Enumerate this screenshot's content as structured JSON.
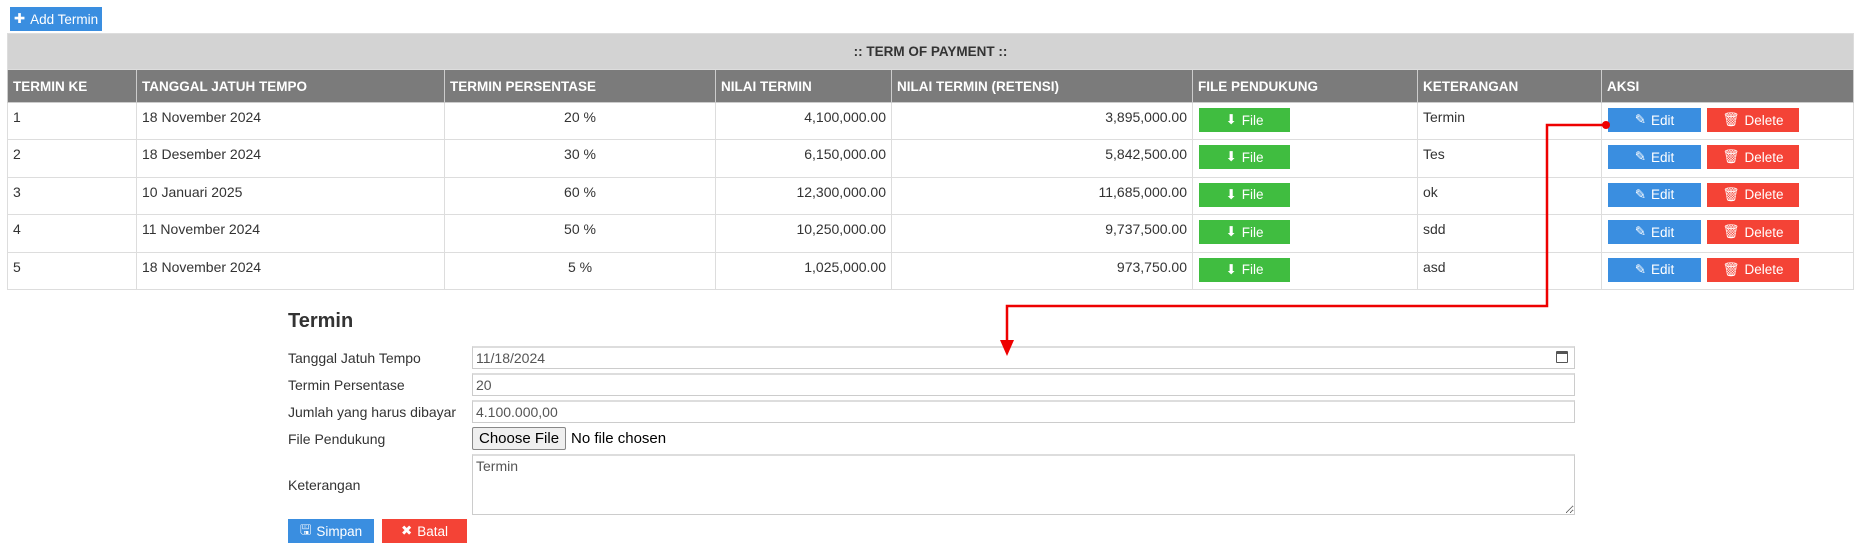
{
  "add_button": "Add Termin",
  "table": {
    "title": ":: TERM OF PAYMENT ::",
    "columns": [
      "TERMIN KE",
      "TANGGAL JATUH TEMPO",
      "TERMIN PERSENTASE",
      "NILAI TERMIN",
      "NILAI TERMIN (RETENSI)",
      "FILE PENDUKUNG",
      "KETERANGAN",
      "AKSI"
    ],
    "rows": [
      {
        "no": "1",
        "tanggal": "18 November 2024",
        "persen": "20 %",
        "nilai": "4,100,000.00",
        "retensi": "3,895,000.00",
        "ket": "Termin"
      },
      {
        "no": "2",
        "tanggal": "18 Desember 2024",
        "persen": "30 %",
        "nilai": "6,150,000.00",
        "retensi": "5,842,500.00",
        "ket": "Tes"
      },
      {
        "no": "3",
        "tanggal": "10 Januari 2025",
        "persen": "60 %",
        "nilai": "12,300,000.00",
        "retensi": "11,685,000.00",
        "ket": "ok"
      },
      {
        "no": "4",
        "tanggal": "11 November 2024",
        "persen": "50 %",
        "nilai": "10,250,000.00",
        "retensi": "9,737,500.00",
        "ket": "sdd"
      },
      {
        "no": "5",
        "tanggal": "18 November 2024",
        "persen": "5 %",
        "nilai": "1,025,000.00",
        "retensi": "973,750.00",
        "ket": "asd"
      }
    ],
    "file_label": "File",
    "edit_label": "Edit",
    "delete_label": "Delete"
  },
  "form": {
    "title": "Termin",
    "tanggal_label": "Tanggal Jatuh Tempo",
    "tanggal_value": "11/18/2024",
    "persen_label": "Termin Persentase",
    "persen_value": "20",
    "jumlah_label": "Jumlah yang harus dibayar",
    "jumlah_value": "4.100.000,00",
    "file_label": "File Pendukung",
    "choose_file": "Choose File",
    "no_file": "No file chosen",
    "ket_label": "Keterangan",
    "ket_value": "Termin",
    "simpan": "Simpan",
    "batal": "Batal"
  },
  "colors": {
    "blue": "#3a8ee0",
    "green": "#40bd40",
    "red": "#f44336",
    "header": "#7b7b7b"
  }
}
